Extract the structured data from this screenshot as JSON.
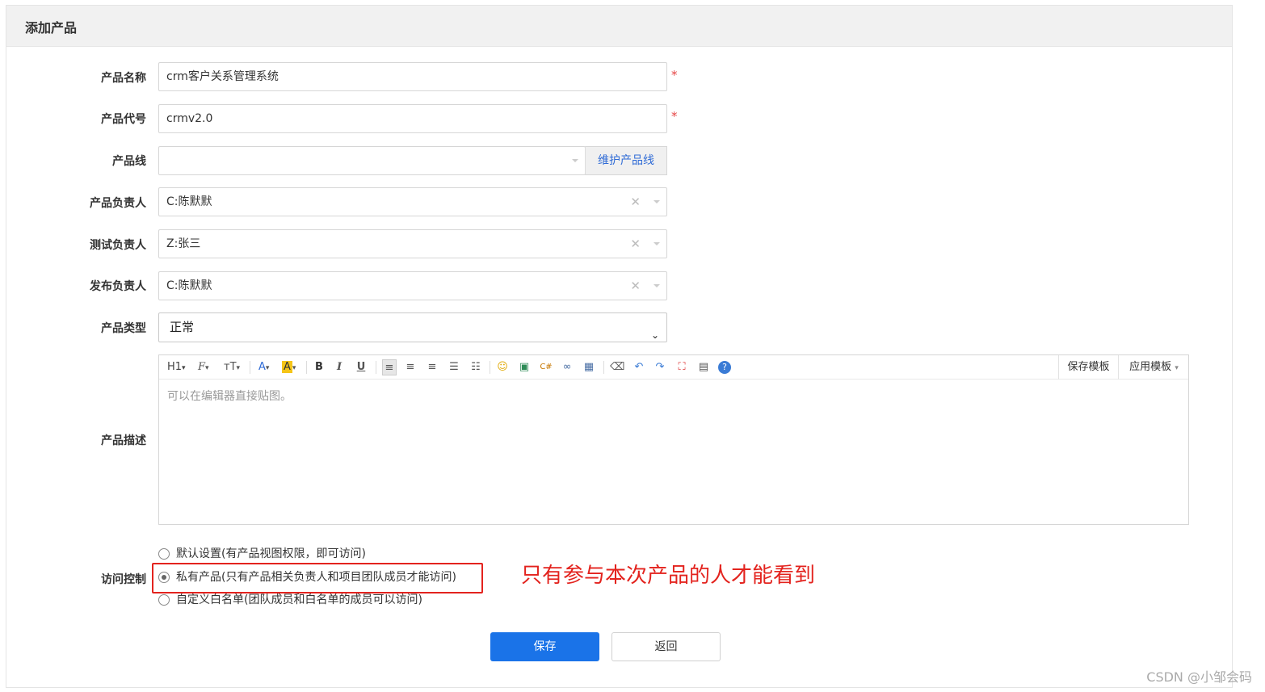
{
  "page": {
    "title": "添加产品"
  },
  "form": {
    "name": {
      "label": "产品名称",
      "value": "crm客户关系管理系统",
      "required": "*"
    },
    "code": {
      "label": "产品代号",
      "value": "crmv2.0",
      "required": "*"
    },
    "line": {
      "label": "产品线",
      "value": "",
      "maintain_button": "维护产品线"
    },
    "owner": {
      "label": "产品负责人",
      "value": "C:陈默默"
    },
    "qa": {
      "label": "测试负责人",
      "value": "Z:张三"
    },
    "release": {
      "label": "发布负责人",
      "value": "C:陈默默"
    },
    "type": {
      "label": "产品类型",
      "value": "正常"
    },
    "desc": {
      "label": "产品描述",
      "placeholder": "可以在编辑器直接贴图。",
      "toolbar": {
        "heading": "H1",
        "font_family": "F",
        "font_size": "тT",
        "save_template": "保存模板",
        "apply_template": "应用模板"
      }
    },
    "acl": {
      "label": "访问控制",
      "options": [
        {
          "text": "默认设置(有产品视图权限，即可访问)",
          "checked": false
        },
        {
          "text": "私有产品(只有产品相关负责人和项目团队成员才能访问)",
          "checked": true
        },
        {
          "text": "自定义白名单(团队成员和白名单的成员可以访问)",
          "checked": false
        }
      ]
    },
    "annotation": "只有参与本次产品的人才能看到"
  },
  "actions": {
    "save": "保存",
    "back": "返回"
  },
  "watermark": "CSDN @小邹会码",
  "colors": {
    "primary": "#1a73e8",
    "annotation_red": "#e3231e",
    "link_blue": "#2f6bd6"
  }
}
